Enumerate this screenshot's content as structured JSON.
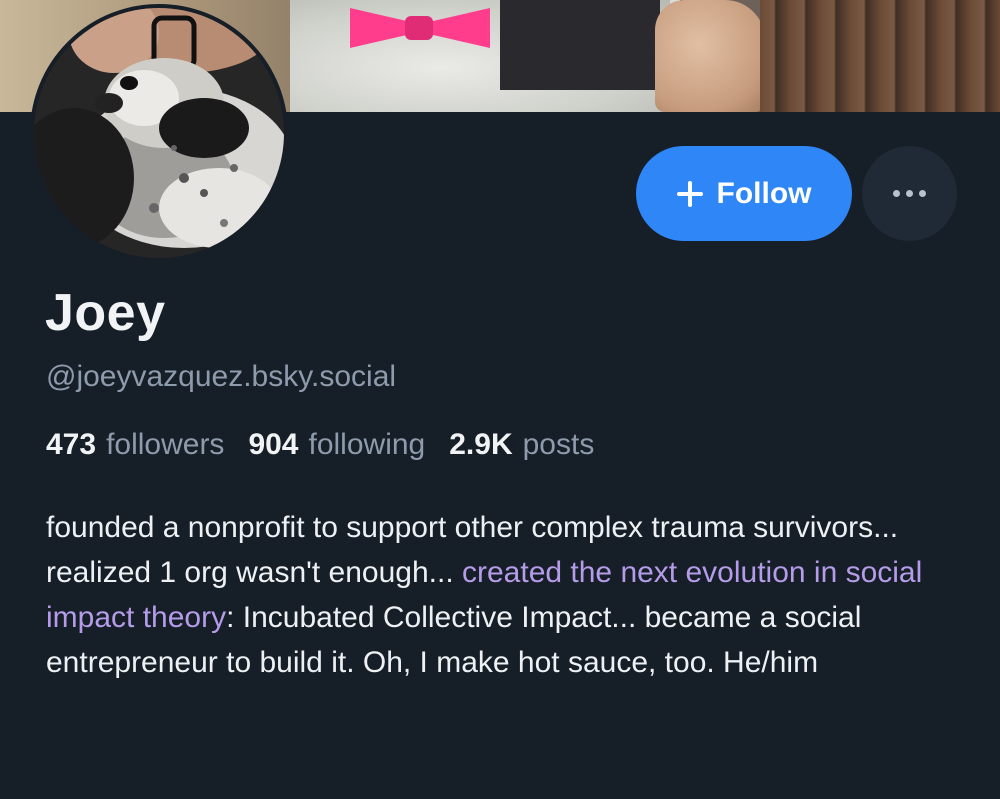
{
  "profile": {
    "display_name": "Joey",
    "handle": "@joeyvazquez.bsky.social",
    "follow_label": "Follow",
    "more_icon": "ellipsis-icon",
    "follow_icon": "plus-icon"
  },
  "stats": {
    "followers_count": "473",
    "followers_label": "followers",
    "following_count": "904",
    "following_label": "following",
    "posts_count": "2.9K",
    "posts_label": "posts"
  },
  "bio": {
    "part1": "founded a nonprofit to support other complex trauma survivors... realized 1 org wasn't enough... ",
    "link_text": "created the next evolution in social impact theory",
    "part2": ": Incubated Collective Impact... became a social entrepreneur to build it. Oh, I make hot sauce, too. He/him"
  },
  "colors": {
    "background": "#161e27",
    "accent": "#2f86f6",
    "link": "#b59ce9",
    "muted": "#8e9bad"
  }
}
